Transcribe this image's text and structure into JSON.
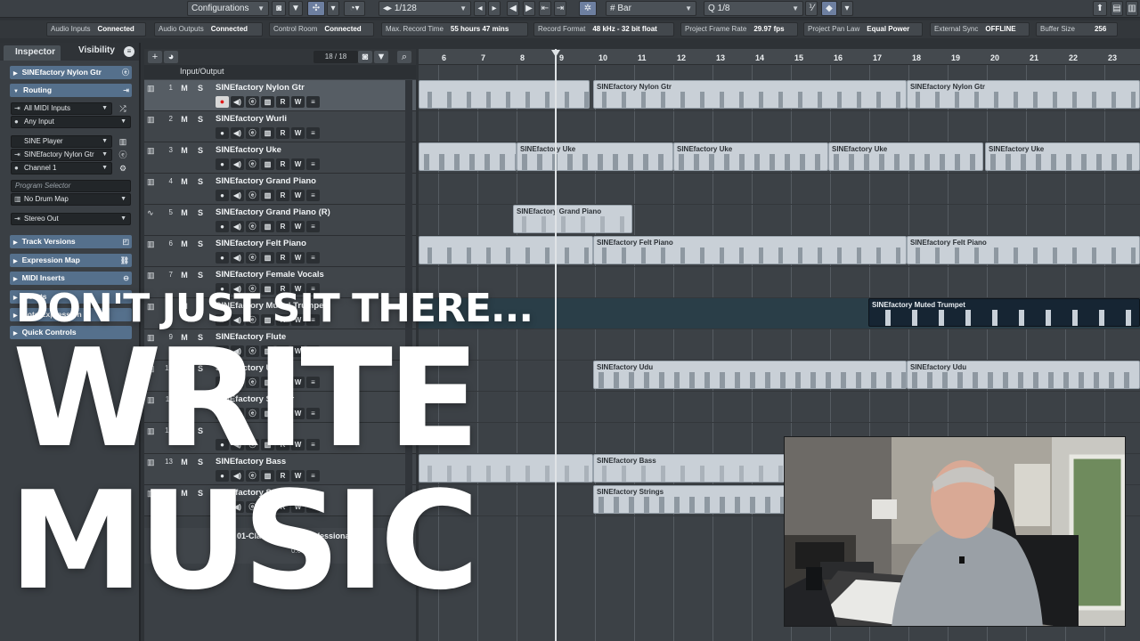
{
  "toolbar": {
    "configurations": "Configurations",
    "quantize": "1/128",
    "grid_type": "Bar",
    "quantize_value": "1/8"
  },
  "status": [
    {
      "label": "Audio Inputs",
      "value": "Connected"
    },
    {
      "label": "Audio Outputs",
      "value": "Connected"
    },
    {
      "label": "Control Room",
      "value": "Connected"
    },
    {
      "label": "Max. Record Time",
      "value": "55 hours 47 mins"
    },
    {
      "label": "Record Format",
      "value": "48 kHz - 32 bit float"
    },
    {
      "label": "Project Frame Rate",
      "value": "29.97 fps"
    },
    {
      "label": "Project Pan Law",
      "value": "Equal Power"
    },
    {
      "label": "External Sync",
      "value": "OFFLINE"
    },
    {
      "label": "Buffer Size",
      "value": "256"
    }
  ],
  "inspector": {
    "tab_inspector": "Inspector",
    "tab_visibility": "Visibility",
    "track_name": "SINEfactory Nylon Gtr",
    "routing": "Routing",
    "midi_input": "All MIDI Inputs",
    "input": "Any Input",
    "instrument": "SINE Player",
    "output_track": "SINEfactory Nylon Gtr",
    "channel": "Channel 1",
    "program_selector": "Program Selector",
    "drum_map": "No Drum Map",
    "stereo_out": "Stereo Out",
    "track_versions": "Track Versions",
    "expression_map": "Expression Map",
    "midi_inserts": "MIDI Inserts",
    "inserts": "Inserts",
    "note_expression": "Note Expression",
    "quick_controls": "Quick Controls"
  },
  "tracklist": {
    "count": "18 / 18",
    "folder": "Input/Output",
    "tracks": [
      {
        "num": "1",
        "name": "SINEfactory Nylon Gtr"
      },
      {
        "num": "2",
        "name": "SINEfactory Wurli"
      },
      {
        "num": "3",
        "name": "SINEfactory Uke"
      },
      {
        "num": "4",
        "name": "SINEfactory Grand Piano"
      },
      {
        "num": "5",
        "name": "SINEfactory Grand Piano (R)"
      },
      {
        "num": "6",
        "name": "SINEfactory Felt Piano"
      },
      {
        "num": "7",
        "name": "SINEfactory Female Vocals"
      },
      {
        "num": "8",
        "name": "SINEfactory Muted Trumpet"
      },
      {
        "num": "9",
        "name": "SINEfactory Flute"
      },
      {
        "num": "10",
        "name": "SINEfactory Udu"
      },
      {
        "num": "11",
        "name": "SINEfactory Shaker"
      },
      {
        "num": "12",
        "name": ""
      },
      {
        "num": "13",
        "name": "SINEfactory Bass"
      },
      {
        "num": "14",
        "name": "SINEfactory Strings"
      }
    ],
    "fx_track": "FX 01-Classic Room Professional",
    "fx_value": "0.00"
  },
  "arrange": {
    "bars": [
      "6",
      "7",
      "8",
      "9",
      "10",
      "11",
      "12",
      "13",
      "14",
      "15",
      "16",
      "17",
      "18",
      "19",
      "20",
      "21",
      "22",
      "23"
    ],
    "parts": {
      "nylon": "SINEfactory Nylon Gtr",
      "uke": "SINEfactory Uke",
      "grand": "SINEfactory Grand Piano",
      "felt": "SINEfactory Felt Piano",
      "trumpet": "SINEfactory Muted Trumpet",
      "udu": "SINEfactory Udu",
      "bass": "SINEfactory Bass",
      "strings": "SINEfactory Strings"
    }
  },
  "overlay": {
    "line1": "DON'T JUST SIT THERE...",
    "line2": "WRITE",
    "line3": "MUSIC"
  },
  "colors": {
    "section_blue": "#55708c",
    "part_light": "#c9d0d7",
    "part_dark": "#162533",
    "record_red": "#e01919"
  }
}
